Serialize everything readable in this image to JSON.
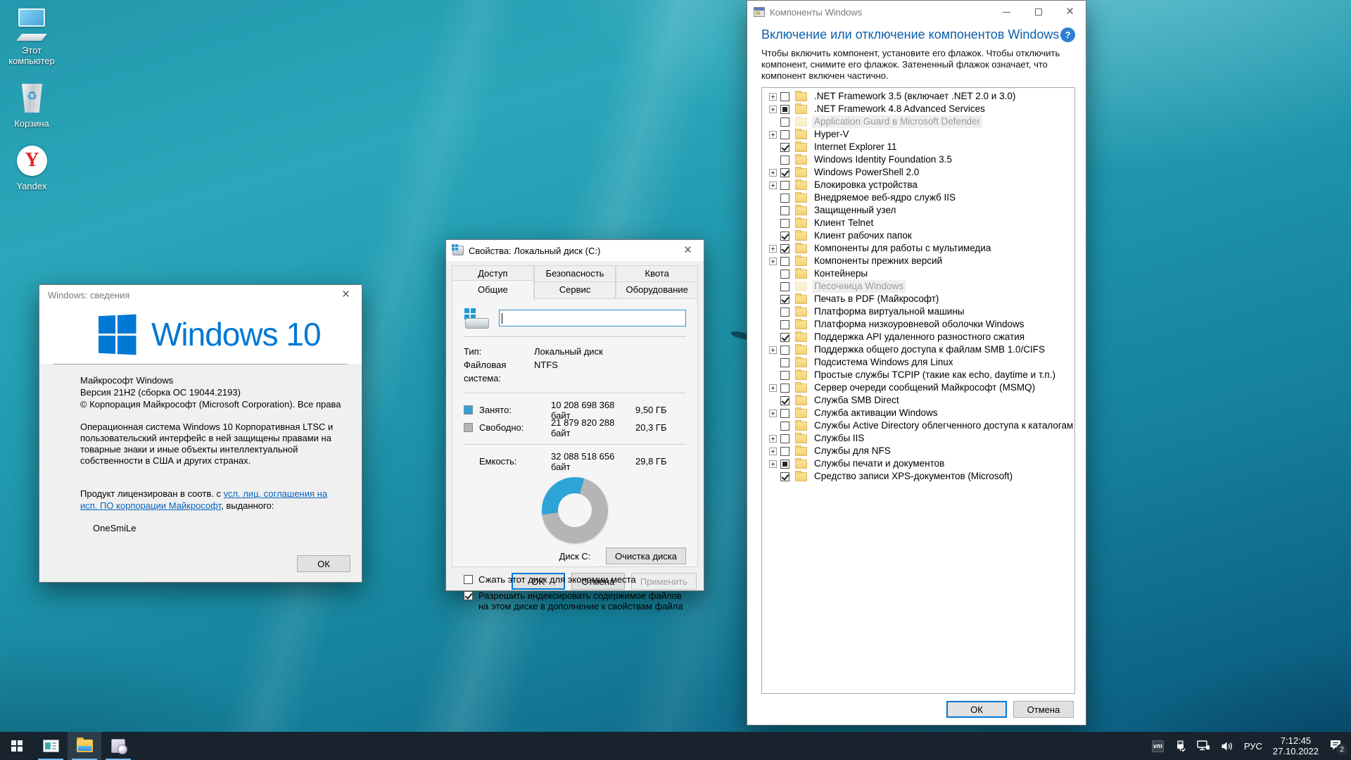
{
  "colors": {
    "accent": "#0078d7",
    "heading_blue": "#0c5fad",
    "link_blue": "#0563c1",
    "taskbar_underline": "#76b9f0",
    "folder_yellow": "#f3d173"
  },
  "desktop": {
    "icons": [
      {
        "name": "desktop-icon-this-pc",
        "label": "Этот компьютер",
        "icon": "computer"
      },
      {
        "name": "desktop-icon-recycle-bin",
        "label": "Корзина",
        "icon": "recycle-bin"
      },
      {
        "name": "desktop-icon-yandex",
        "label": "Yandex",
        "icon": "yandex"
      }
    ]
  },
  "about_dialog": {
    "title": "Windows: сведения",
    "logo_text": "Windows 10",
    "product": "Майкрософт Windows",
    "version": "Версия 21H2 (сборка ОС 19044.2193)",
    "copyright": "© Корпорация Майкрософт (Microsoft Corporation). Все права",
    "description": "Операционная система Windows 10 Корпоративная LTSC и пользовательский интерфейс в ней защищены правами на товарные знаки и иные объекты интеллектуальной собственности в США и других странах.",
    "license_prefix": "Продукт лицензирован в соотв. с ",
    "license_link_line1": "усл. лиц. соглашения на",
    "license_link_line2": "исп. ПО корпорации Майкрософт",
    "license_suffix": ", выданного:",
    "licensee": "OneSmiLe",
    "ok_label": "ОК"
  },
  "properties_dialog": {
    "title": "Свойства: Локальный диск (C:)",
    "tabs_back": [
      {
        "name": "tab-access",
        "label": "Доступ"
      },
      {
        "name": "tab-security",
        "label": "Безопасность"
      },
      {
        "name": "tab-quota",
        "label": "Квота"
      }
    ],
    "tabs_front": [
      {
        "name": "tab-general",
        "label": "Общие",
        "active": true
      },
      {
        "name": "tab-tools",
        "label": "Сервис"
      },
      {
        "name": "tab-hardware",
        "label": "Оборудование"
      }
    ],
    "volume_label_value": "",
    "fields": [
      {
        "label": "Тип:",
        "value": "Локальный диск"
      },
      {
        "label": "Файловая система:",
        "value": "NTFS"
      }
    ],
    "usage": {
      "used": {
        "label": "Занято:",
        "bytes": "10 208 698 368 байт",
        "size": "9,50 ГБ",
        "color": "#2da4d8"
      },
      "free": {
        "label": "Свободно:",
        "bytes": "21 879 820 288 байт",
        "size": "20,3 ГБ",
        "color": "#b5b5b5"
      },
      "capacity": {
        "label": "Емкость:",
        "bytes": "32 088 518 656 байт",
        "size": "29,8 ГБ"
      },
      "used_percent": 31.8
    },
    "disk_label": "Диск C:",
    "cleanup_button": "Очистка диска",
    "checkboxes": [
      {
        "name": "compress-checkbox-row",
        "label": "Сжать этот диск для экономии места",
        "checked": false
      },
      {
        "name": "index-checkbox-row",
        "label": "Разрешить индексировать содержимое файлов на этом диске в дополнение к свойствам файла",
        "checked": true
      }
    ],
    "buttons": {
      "ok": "OK",
      "cancel": "Отмена",
      "apply": "Применить"
    }
  },
  "features_dialog": {
    "title": "Компоненты Windows",
    "heading": "Включение или отключение компонентов Windows",
    "help_glyph": "?",
    "description": "Чтобы включить компонент, установите его флажок. Чтобы отключить компонент, снимите его флажок. Затененный флажок означает, что компонент включен частично.",
    "items": [
      {
        "label": ".NET Framework 3.5 (включает .NET 2.0 и 3.0)",
        "state": "unchecked",
        "expandable": true
      },
      {
        "label": ".NET Framework 4.8 Advanced Services",
        "state": "partial",
        "expandable": true
      },
      {
        "label": "Application Guard в Microsoft Defender",
        "state": "unchecked",
        "disabled": true
      },
      {
        "label": "Hyper-V",
        "state": "unchecked",
        "expandable": true
      },
      {
        "label": "Internet Explorer 11",
        "state": "checked"
      },
      {
        "label": "Windows Identity Foundation 3.5",
        "state": "unchecked"
      },
      {
        "label": "Windows PowerShell 2.0",
        "state": "checked",
        "expandable": true
      },
      {
        "label": "Блокировка устройства",
        "state": "unchecked",
        "expandable": true
      },
      {
        "label": "Внедряемое веб-ядро служб IIS",
        "state": "unchecked"
      },
      {
        "label": "Защищенный узел",
        "state": "unchecked"
      },
      {
        "label": "Клиент Telnet",
        "state": "unchecked"
      },
      {
        "label": "Клиент рабочих папок",
        "state": "checked"
      },
      {
        "label": "Компоненты для работы с мультимедиа",
        "state": "checked",
        "expandable": true
      },
      {
        "label": "Компоненты прежних версий",
        "state": "unchecked",
        "expandable": true
      },
      {
        "label": "Контейнеры",
        "state": "unchecked"
      },
      {
        "label": "Песочница Windows",
        "state": "unchecked",
        "disabled": true
      },
      {
        "label": "Печать в PDF (Майкрософт)",
        "state": "checked"
      },
      {
        "label": "Платформа виртуальной машины",
        "state": "unchecked"
      },
      {
        "label": "Платформа низкоуровневой оболочки Windows",
        "state": "unchecked"
      },
      {
        "label": "Поддержка API удаленного разностного сжатия",
        "state": "checked"
      },
      {
        "label": "Поддержка общего доступа к файлам SMB 1.0/CIFS",
        "state": "unchecked",
        "expandable": true
      },
      {
        "label": "Подсистема Windows для Linux",
        "state": "unchecked"
      },
      {
        "label": "Простые службы TCPIP (такие как echo, daytime и т.п.)",
        "state": "unchecked"
      },
      {
        "label": "Сервер очереди сообщений Майкрософт (MSMQ)",
        "state": "unchecked",
        "expandable": true
      },
      {
        "label": "Служба SMB Direct",
        "state": "checked"
      },
      {
        "label": "Служба активации Windows",
        "state": "unchecked",
        "expandable": true
      },
      {
        "label": "Службы Active Directory облегченного доступа к каталогам",
        "state": "unchecked"
      },
      {
        "label": "Службы IIS",
        "state": "unchecked",
        "expandable": true
      },
      {
        "label": "Службы для NFS",
        "state": "unchecked",
        "expandable": true
      },
      {
        "label": "Службы печати и документов",
        "state": "partial",
        "expandable": true
      },
      {
        "label": "Средство записи XPS-документов (Microsoft)",
        "state": "checked"
      }
    ],
    "buttons": {
      "ok": "ОК",
      "cancel": "Отмена"
    }
  },
  "taskbar": {
    "apps": [
      {
        "name": "start-button",
        "icon": "start"
      },
      {
        "name": "taskbar-app-about",
        "icon": "about-window",
        "running": true
      },
      {
        "name": "taskbar-app-explorer",
        "icon": "explorer",
        "running": true,
        "active": true
      },
      {
        "name": "taskbar-app-features",
        "icon": "features",
        "running": true
      }
    ],
    "tray": {
      "vm_label": "vm",
      "language": "РУС",
      "time": "7:12:45",
      "date": "27.10.2022",
      "notification_count": "2"
    }
  }
}
